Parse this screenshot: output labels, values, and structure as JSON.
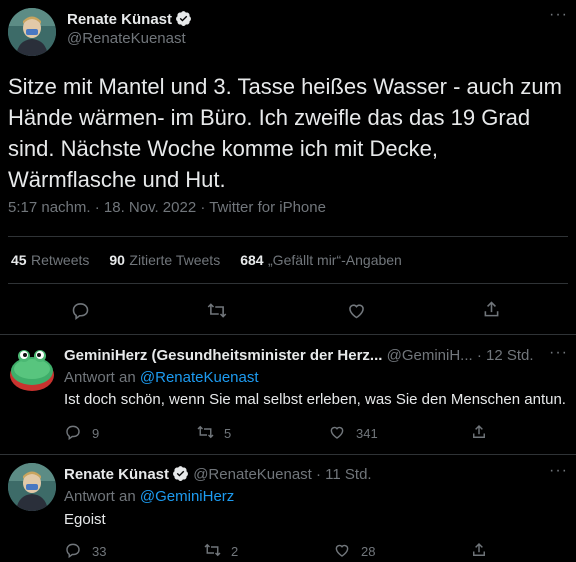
{
  "main_tweet": {
    "author_name": "Renate Künast",
    "handle": "@RenateKuenast",
    "text": "Sitze mit Mantel und 3. Tasse heißes Wasser - auch zum Hände wärmen- im Büro. Ich zweifle das das 19 Grad sind. Nächste Woche komme ich mit Decke, Wärmflasche und Hut.",
    "timestamp": "5:17 nachm. · 18. Nov. 2022 · Twitter for iPhone",
    "stats": {
      "retweets_count": "45",
      "retweets_label": "Retweets",
      "quotes_count": "90",
      "quotes_label": "Zitierte Tweets",
      "likes_count": "684",
      "likes_label": "„Gefällt mir“-Angaben"
    }
  },
  "replies": [
    {
      "author_name": "GeminiHerz (Gesundheitsminister der Herz...",
      "handle": "@GeminiH...",
      "time": "· 12 Std.",
      "reply_to_label": "Antwort an",
      "reply_to_handle": "@RenateKuenast",
      "text": "Ist doch schön, wenn Sie mal selbst erleben, was Sie den Menschen antun.",
      "reply_count": "9",
      "retweet_count": "5",
      "like_count": "341"
    },
    {
      "author_name": "Renate Künast",
      "handle": "@RenateKuenast",
      "time": "· 11 Std.",
      "reply_to_label": "Antwort an",
      "reply_to_handle": "@GeminiHerz",
      "text": "Egoist",
      "reply_count": "33",
      "retweet_count": "2",
      "like_count": "28"
    }
  ],
  "more_icon": "···",
  "colors": {
    "background": "#000000",
    "text": "#e7e9ea",
    "muted": "#71767b",
    "link": "#1d9bf0",
    "divider": "#2f3336",
    "verified": "#e7e9ea"
  }
}
